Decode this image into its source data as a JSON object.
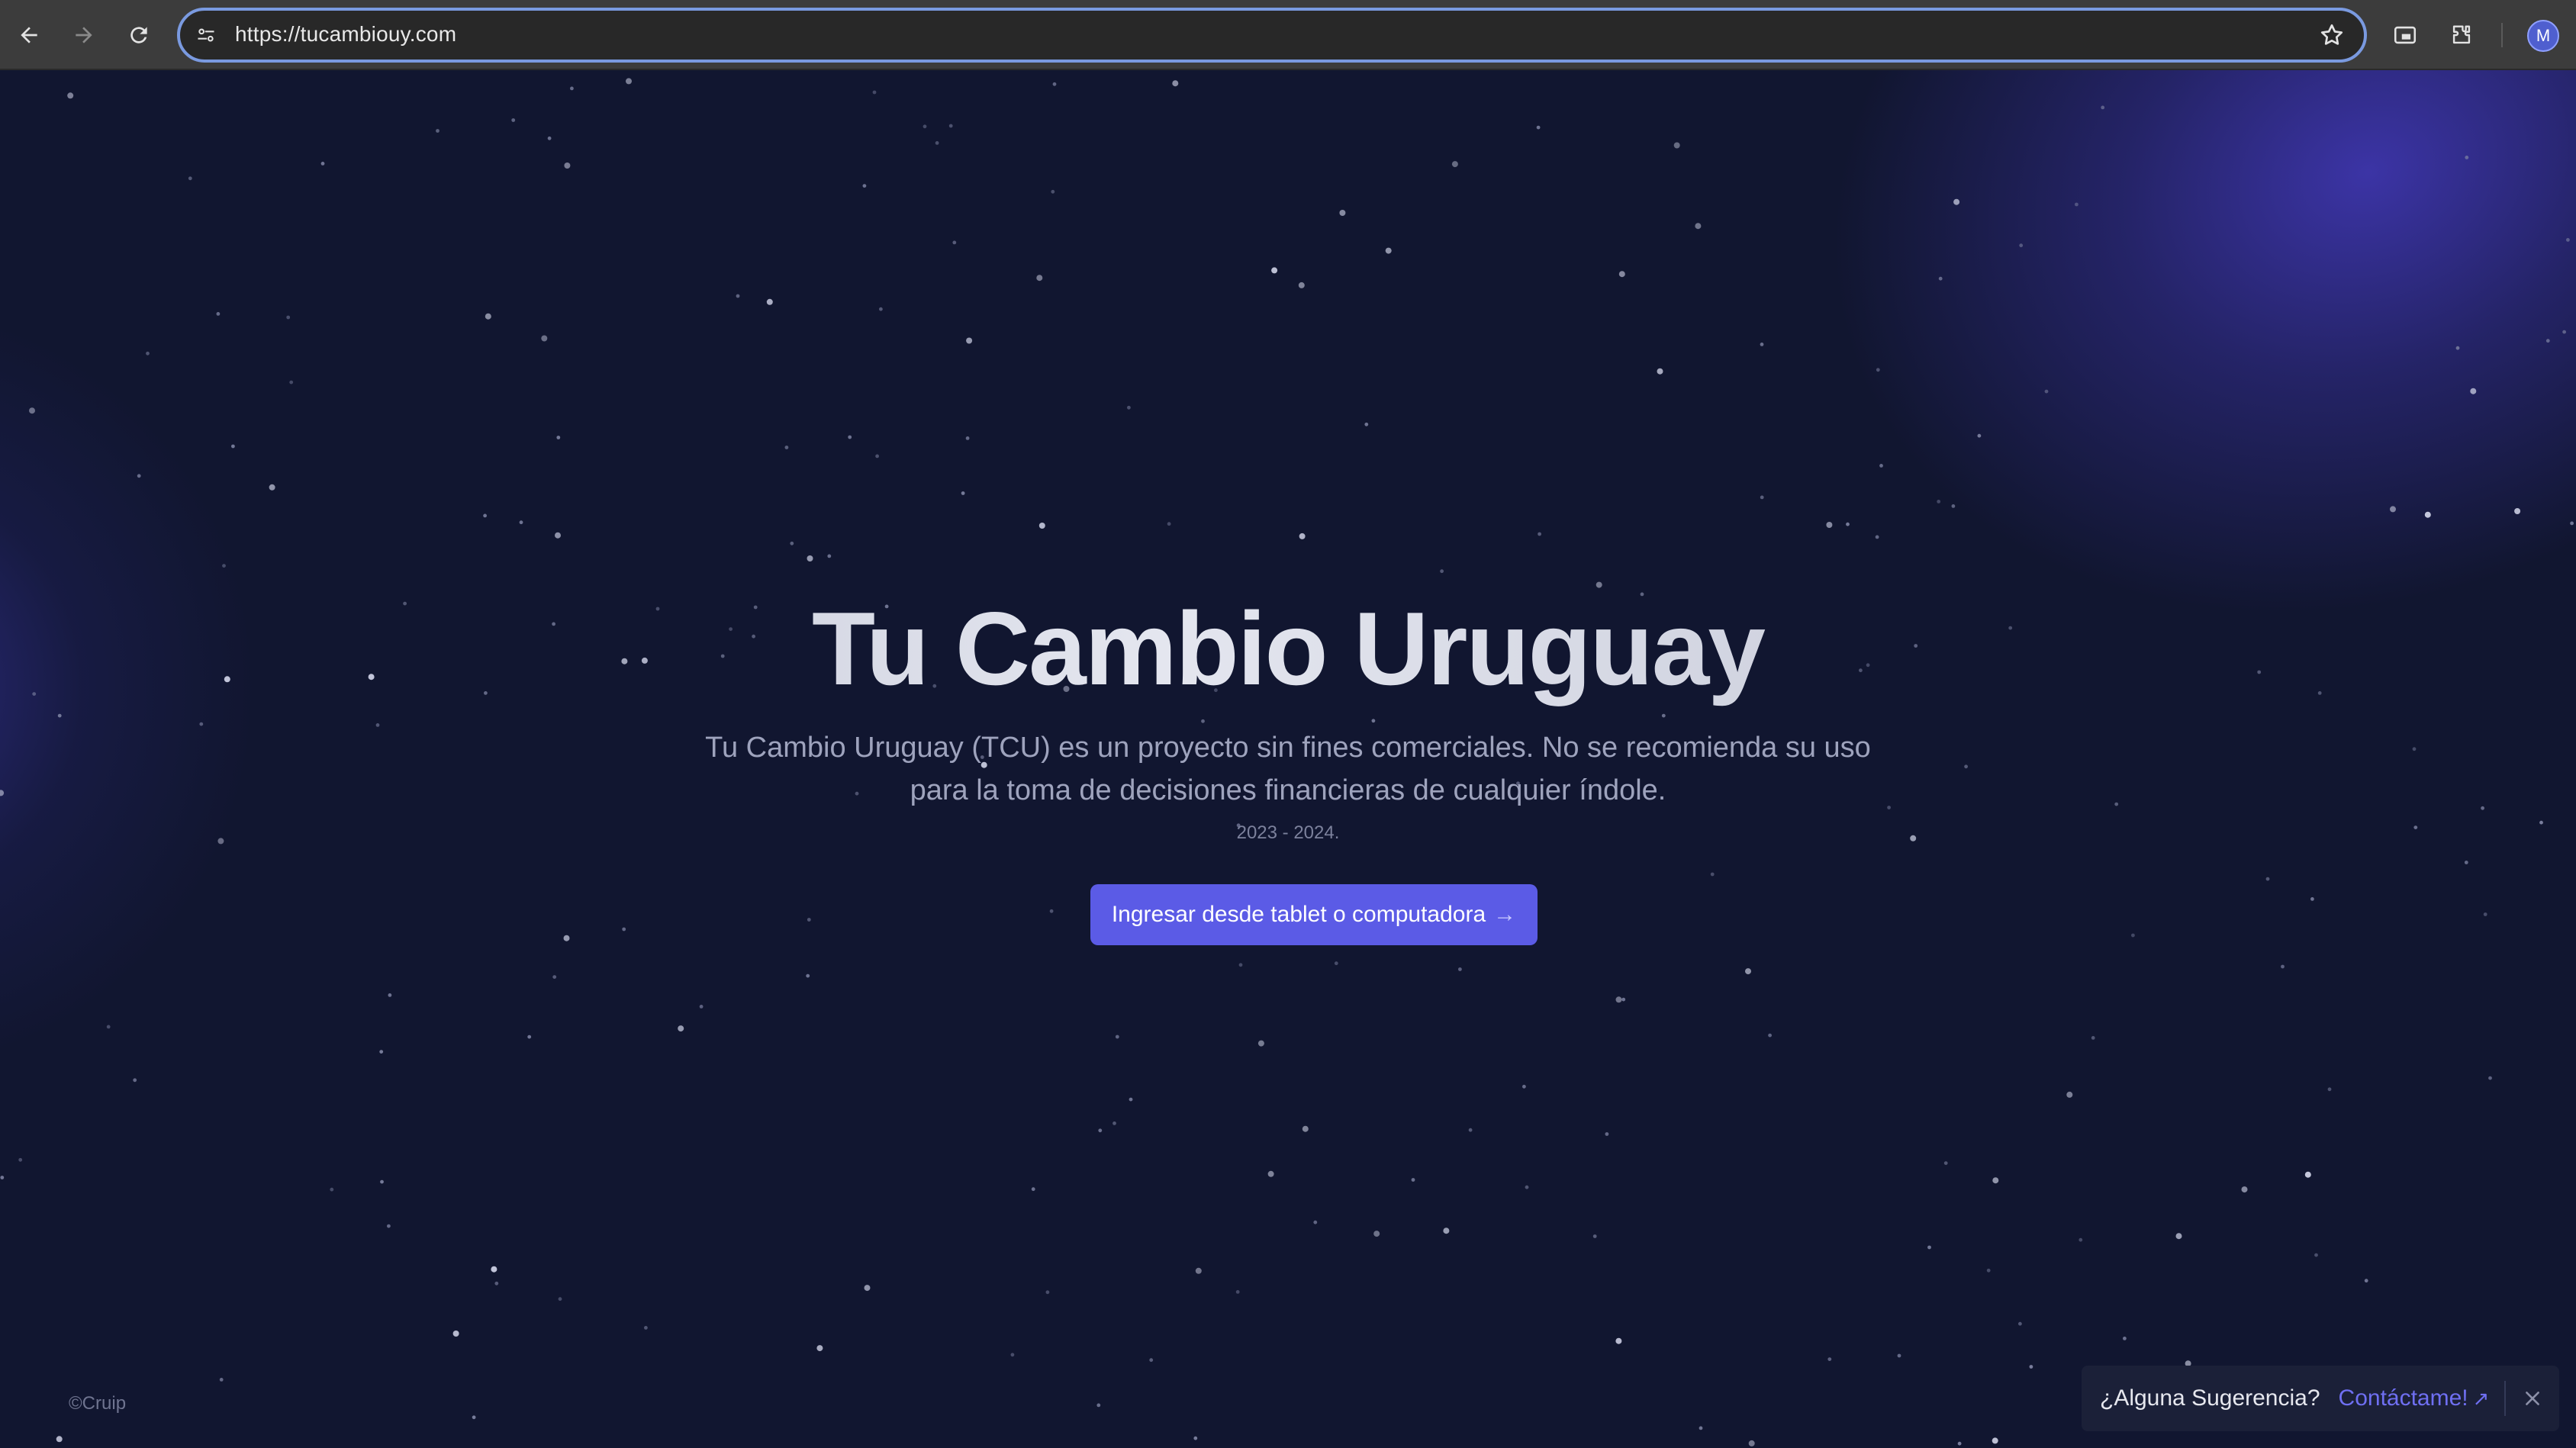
{
  "browser": {
    "url": "https://tucambiouy.com",
    "profile_initial": "M",
    "icons": [
      "back-icon",
      "forward-icon",
      "reload-icon",
      "site-settings-icon",
      "bookmark-star-icon",
      "cast-icon",
      "extensions-icon"
    ]
  },
  "hero": {
    "title": "Tu Cambio Uruguay",
    "description": "Tu Cambio Uruguay (TCU) es un proyecto sin fines comerciales. No se recomienda su uso para la toma de decisiones financieras de cualquier índole.",
    "years": "2023 - 2024.",
    "cta_label": "Ingresar desde tablet o computadora",
    "cta_arrow": "→"
  },
  "footer": {
    "copyright": "©Cruip"
  },
  "toast": {
    "question": "¿Alguna Sugerencia?",
    "link_label": "Contáctame!",
    "link_arrow": "↗",
    "close_symbol": "✕"
  },
  "colors": {
    "background": "#111630",
    "accent": "#5b5be6",
    "link": "#6f6ff2",
    "chrome": "#3c3c3c",
    "omnibox_focus": "#7a9ae0"
  }
}
